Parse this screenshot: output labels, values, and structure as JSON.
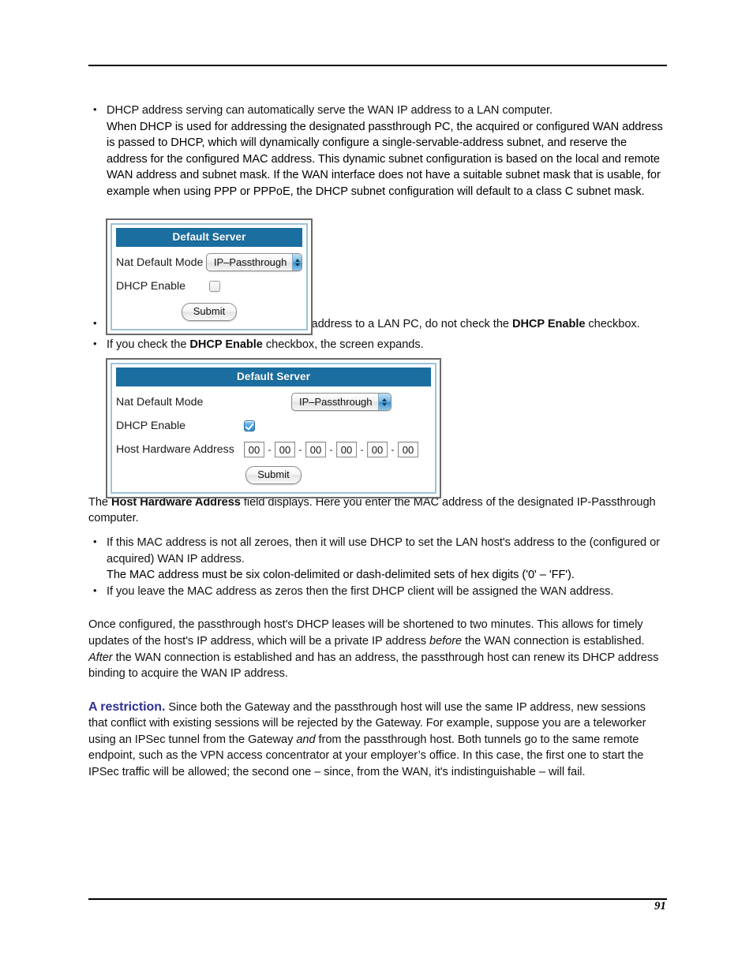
{
  "document": {
    "page_number": "91"
  },
  "intro": {
    "bullet1": "DHCP address serving can automatically serve the WAN IP address to a LAN computer.",
    "paragraph1": "When DHCP is used for addressing the designated passthrough PC, the acquired or configured WAN address is passed to DHCP, which will dynamically configure a single-servable-address subnet, and reserve the address for the configured MAC address. This dynamic subnet configuration is based on the local and remote WAN address and subnet mask. If the WAN interface does not have a suitable subnet mask that is usable, for example when using PPP or PPPoE, the DHCP subnet configuration will default to a class C subnet mask."
  },
  "bullets_middle": {
    "b1_part1": "If you want to manually assign the WAN address to a LAN PC, do not check the ",
    "b1_bold": "DHCP Enable",
    "b1_part2": " checkbox.",
    "b2_part1": "If you check the ",
    "b2_bold": "DHCP Enable",
    "b2_part2": " checkbox, the screen expands."
  },
  "screenshot1": {
    "title": "Default Server",
    "nat_label": "Nat Default Mode",
    "nat_value": "IP–Passthrough",
    "dhcp_label": "DHCP Enable",
    "dhcp_checked": false,
    "submit_label": "Submit"
  },
  "screenshot2": {
    "title": "Default Server",
    "nat_label": "Nat Default Mode",
    "nat_value": "IP–Passthrough",
    "dhcp_label": "DHCP Enable",
    "dhcp_checked": true,
    "mac_label": "Host Hardware Address",
    "mac_octets": [
      "00",
      "00",
      "00",
      "00",
      "00",
      "00"
    ],
    "mac_separator": "-",
    "submit_label": "Submit"
  },
  "after_shot2": {
    "para_part1": "The ",
    "para_bold": "Host Hardware Address",
    "para_part2": " field displays. Here you enter the MAC address of the designated IP-Passthrough computer.",
    "bullet1": "If this MAC address is not all zeroes, then it will use DHCP to set the LAN host's address to the (configured or acquired) WAN IP address.",
    "sub1": "The MAC address must be six colon-delimited or dash-delimited sets of hex digits ('0' – 'FF').",
    "bullet2": "If you leave the MAC address as zeros then the first DHCP client will be assigned the WAN address."
  },
  "leases_paragraph": {
    "p1": "Once configured, the passthrough host's DHCP leases will be shortened to two minutes. This allows for timely updates of the host's IP address, which will be a private IP address ",
    "em1": "before",
    "p2": " the WAN connection is established. ",
    "em2": "After",
    "p3": " the WAN connection is established and has an address, the passthrough host can renew its DHCP address binding to acquire the WAN IP address."
  },
  "restriction": {
    "lead": "A restriction.",
    "p1": " Since both the Gateway and the passthrough host will use the same IP address, new sessions that conflict with existing sessions will be rejected by the Gateway. For example, suppose you are a teleworker using an IPSec tunnel from the Gateway ",
    "em1": "and",
    "p2": " from the passthrough host. Both tunnels go to the same remote endpoint, such as the VPN access concentrator at your employer’s office. In this case, the first one to start the IPSec traffic will be allowed; the second one – since, from the WAN, it's indistinguishable – will fail."
  },
  "colors": {
    "title_bar": "#1a6ea0",
    "restriction_lead": "#2e3192",
    "inner_border": "#9dc3d8",
    "outer_border": "#6a6a6a"
  }
}
